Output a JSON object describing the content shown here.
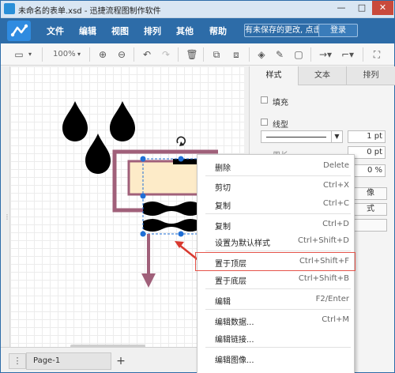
{
  "window": {
    "title": "未命名的表单.xsd - 迅捷流程图制作软件",
    "controls": {
      "minimize": "—",
      "maximize": "□",
      "close": "✕"
    }
  },
  "menubar": {
    "items": [
      "文件",
      "编辑",
      "视图",
      "排列",
      "其他",
      "帮助"
    ],
    "unsaved_notice": "有未保存的更改, 点击此处保存",
    "login": "登录"
  },
  "toolbar": {
    "zoom": "100%",
    "icons": [
      "page-view-icon",
      "zoom-in-icon",
      "zoom-out-icon",
      "undo-icon",
      "redo-icon",
      "delete-icon",
      "to-front-icon",
      "to-back-icon",
      "fill-color-icon",
      "line-color-icon",
      "shadow-icon",
      "connection-icon",
      "waypoints-icon",
      "fullscreen-icon"
    ]
  },
  "panel": {
    "tabs": [
      "样式",
      "文本",
      "排列"
    ],
    "fill_label": "填充",
    "line_label": "线型",
    "line_width": "1 pt",
    "perimeter_label": "周长",
    "perimeter_value": "0 pt",
    "opacity_value": "0 %",
    "button_labels": [
      "像",
      "式"
    ]
  },
  "bottombar": {
    "menu_icon": "⋮",
    "page_name": "Page-1",
    "add_icon": "+"
  },
  "context_menu": {
    "groups": [
      [
        {
          "label": "删除",
          "shortcut": "Delete"
        }
      ],
      [
        {
          "label": "剪切",
          "shortcut": "Ctrl+X"
        },
        {
          "label": "复制",
          "shortcut": "Ctrl+C"
        }
      ],
      [
        {
          "label": "复制",
          "shortcut": "Ctrl+D"
        },
        {
          "label": "设置为默认样式",
          "shortcut": "Ctrl+Shift+D"
        }
      ],
      [
        {
          "label": "置于顶层",
          "shortcut": "Ctrl+Shift+F"
        },
        {
          "label": "置于底层",
          "shortcut": "Ctrl+Shift+B"
        }
      ],
      [
        {
          "label": "编辑",
          "shortcut": "F2/Enter"
        }
      ],
      [
        {
          "label": "编辑数据...",
          "shortcut": "Ctrl+M"
        },
        {
          "label": "编辑链接...",
          "shortcut": ""
        }
      ],
      [
        {
          "label": "编辑图像...",
          "shortcut": ""
        }
      ]
    ],
    "highlighted_label": "置于顶层"
  },
  "colors": {
    "menubar": "#2d6ca8",
    "highlight_border": "#e5544a",
    "arrow": "#a0607a",
    "selection_handle": "#1f6fd6",
    "shape_fill": "#fdebc8"
  }
}
